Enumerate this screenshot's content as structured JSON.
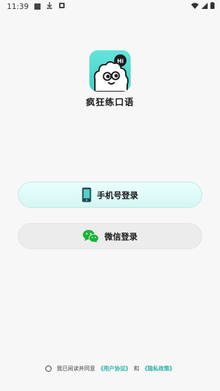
{
  "status_bar": {
    "time": "11:39"
  },
  "app": {
    "name": "疯狂练口语",
    "badge_text": "Hi",
    "brand_color": "#3fd0c6"
  },
  "login": {
    "phone_label": "手机号登录",
    "wechat_label": "微信登录"
  },
  "agreement": {
    "prefix": "我已阅读并同意",
    "user_agreement": "《用户协议》",
    "conjunction": "和",
    "privacy_policy": "《隐私政策》",
    "checked": false
  },
  "colors": {
    "phone_button_bg": "#d4f6f3",
    "wechat_button_bg": "#ececec",
    "wechat_green": "#19b534",
    "link_color": "#2bb3a8"
  }
}
